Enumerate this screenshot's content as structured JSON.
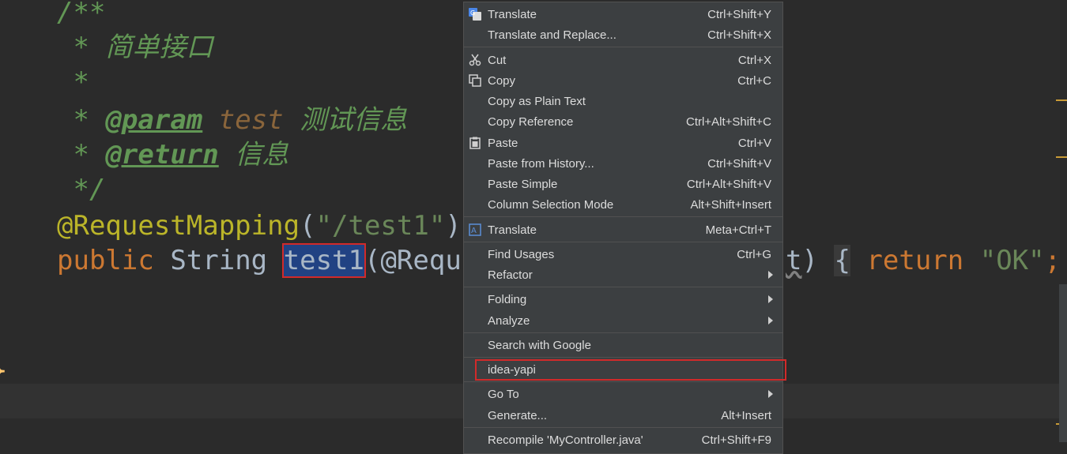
{
  "editor": {
    "doc_open": "/**",
    "doc_star": "*",
    "doc_summary": "简单接口",
    "param_tag": "@param",
    "param_name": "test",
    "param_desc": "测试信息",
    "return_tag": "@return",
    "return_desc": "信息",
    "doc_close": "*/",
    "annotation": "@RequestMapping",
    "annotation_open": "(",
    "annotation_value": "\"/test1\"",
    "annotation_close": ")",
    "kw_public": "public",
    "type_string": "String",
    "method_name": "test1",
    "params_start": "(@Requ",
    "params_end_hidden": "t",
    "params_close": ")",
    "brace_open": "{",
    "kw_return": "return",
    "return_value": "\"OK\"",
    "semicolon": ";",
    "class_brace": "}"
  },
  "context_menu": {
    "items": [
      {
        "label": "Translate",
        "shortcut": "Ctrl+Shift+Y",
        "icon": "google-translate-icon"
      },
      {
        "label": "Translate and Replace...",
        "shortcut": "Ctrl+Shift+X"
      },
      {
        "label": "Cut",
        "shortcut": "Ctrl+X",
        "icon": "scissors-icon"
      },
      {
        "label": "Copy",
        "shortcut": "Ctrl+C",
        "icon": "copy-icon"
      },
      {
        "label": "Copy as Plain Text",
        "shortcut": ""
      },
      {
        "label": "Copy Reference",
        "shortcut": "Ctrl+Alt+Shift+C"
      },
      {
        "label": "Paste",
        "shortcut": "Ctrl+V",
        "icon": "clipboard-icon"
      },
      {
        "label": "Paste from History...",
        "shortcut": "Ctrl+Shift+V"
      },
      {
        "label": "Paste Simple",
        "shortcut": "Ctrl+Alt+Shift+V"
      },
      {
        "label": "Column Selection Mode",
        "shortcut": "Alt+Shift+Insert"
      },
      {
        "label": "Translate",
        "shortcut": "Meta+Ctrl+T",
        "icon": "translate-icon"
      },
      {
        "label": "Find Usages",
        "shortcut": "Ctrl+G"
      },
      {
        "label": "Refactor",
        "shortcut": "",
        "submenu": true
      },
      {
        "label": "Folding",
        "shortcut": "",
        "submenu": true
      },
      {
        "label": "Analyze",
        "shortcut": "",
        "submenu": true
      },
      {
        "label": "Search with Google",
        "shortcut": ""
      },
      {
        "label": "idea-yapi",
        "shortcut": ""
      },
      {
        "label": "Go To",
        "shortcut": "",
        "submenu": true
      },
      {
        "label": "Generate...",
        "shortcut": "Alt+Insert"
      },
      {
        "label": "Recompile 'MyController.java'",
        "shortcut": "Ctrl+Shift+F9"
      }
    ]
  },
  "colors": {
    "editor_bg": "#2b2b2b",
    "menu_bg": "#3c3f41",
    "highlight_border": "#d12a2a",
    "selection_bg": "#214283"
  }
}
